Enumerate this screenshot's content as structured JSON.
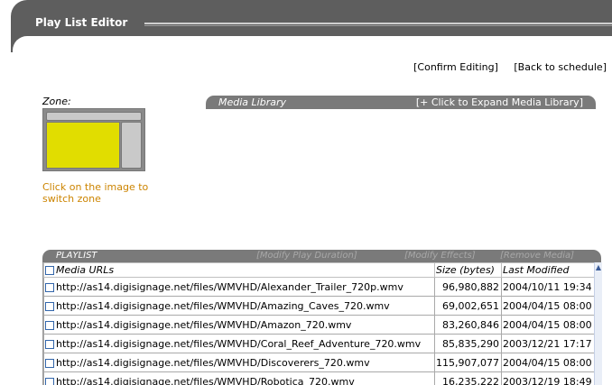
{
  "window": {
    "title": "Play List Editor"
  },
  "toplinks": {
    "confirm": "[Confirm Editing]",
    "back": "[Back to schedule]"
  },
  "zone": {
    "label": "Zone:",
    "help": "Click on the image to switch zone"
  },
  "media_library": {
    "label": "Media Library",
    "expand": "[+ Click to Expand Media Library]"
  },
  "playlist": {
    "label": "PLAYLIST",
    "actions": [
      "[Modify Play Duration]",
      "[Modify Effects]",
      "[Remove Media]"
    ],
    "columns": {
      "url": "Media URLs",
      "size": "Size (bytes)",
      "modified": "Last Modified"
    },
    "rows": [
      {
        "url": "http://as14.digisignage.net/files/WMVHD/Alexander_Trailer_720p.wmv",
        "size": "96,980,882",
        "modified": "2004/10/11 19:34"
      },
      {
        "url": "http://as14.digisignage.net/files/WMVHD/Amazing_Caves_720.wmv",
        "size": "69,002,651",
        "modified": "2004/04/15 08:00"
      },
      {
        "url": "http://as14.digisignage.net/files/WMVHD/Amazon_720.wmv",
        "size": "83,260,846",
        "modified": "2004/04/15 08:00"
      },
      {
        "url": "http://as14.digisignage.net/files/WMVHD/Coral_Reef_Adventure_720.wmv",
        "size": "85,835,290",
        "modified": "2003/12/21 17:17"
      },
      {
        "url": "http://as14.digisignage.net/files/WMVHD/Discoverers_720.wmv",
        "size": "115,907,077",
        "modified": "2004/04/15 08:00"
      },
      {
        "url": "http://as14.digisignage.net/files/WMVHD/Robotica_720.wmv",
        "size": "16,235,222",
        "modified": "2003/12/19 18:49"
      }
    ]
  }
}
